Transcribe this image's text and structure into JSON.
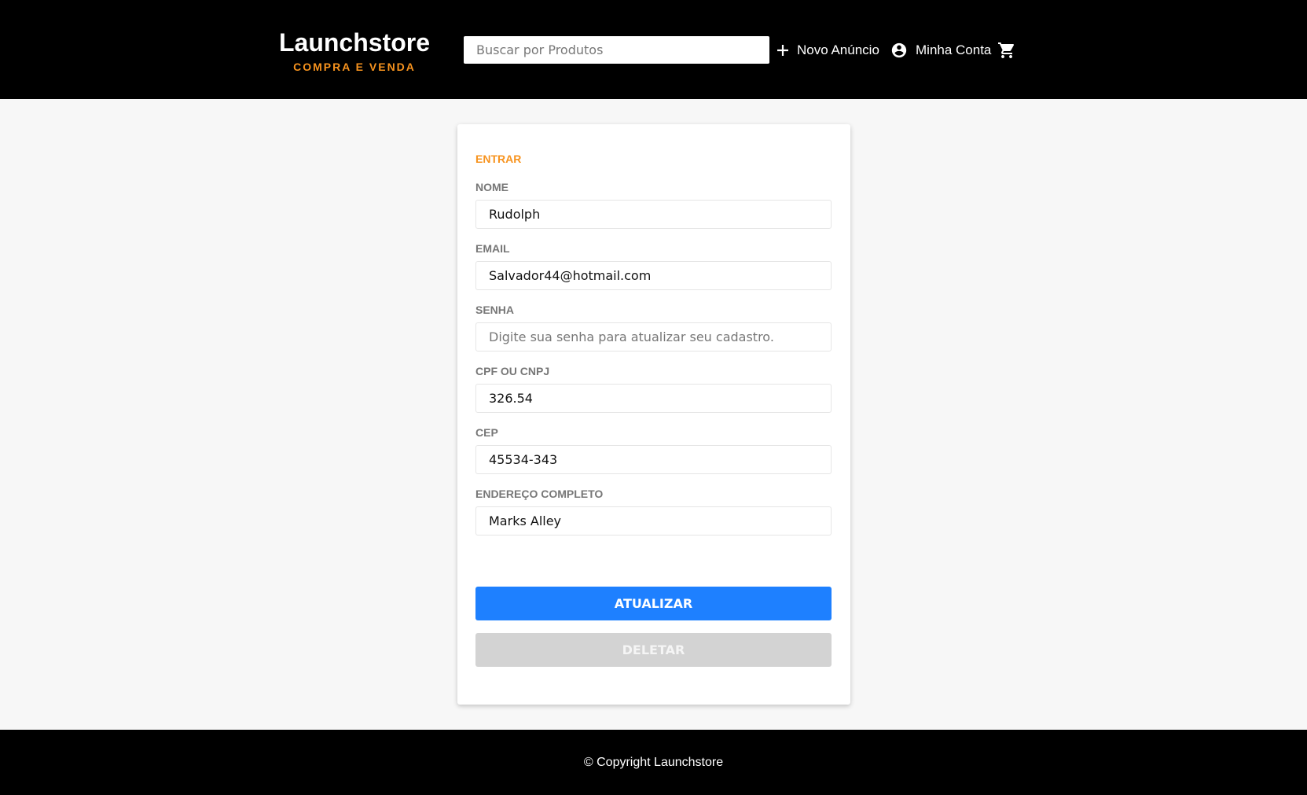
{
  "header": {
    "logo_title": "Launchstore",
    "logo_subtitle": "COMPRA E VENDA",
    "search_placeholder": "Buscar por Produtos",
    "new_ad_label": "Novo Anúncio",
    "account_label": "Minha Conta",
    "icons": {
      "new_ad": "plus-icon",
      "account": "account-circle-icon",
      "cart": "shopping-cart-icon"
    }
  },
  "form": {
    "heading": "ENTRAR",
    "fields": [
      {
        "label": "NOME",
        "value": "Rudolph",
        "placeholder": ""
      },
      {
        "label": "EMAIL",
        "value": "Salvador44@hotmail.com",
        "placeholder": ""
      },
      {
        "label": "SENHA",
        "value": "",
        "placeholder": "Digite sua senha para atualizar seu cadastro."
      },
      {
        "label": "CPF OU CNPJ",
        "value": "326.54",
        "placeholder": ""
      },
      {
        "label": "CEP",
        "value": "45534-343",
        "placeholder": ""
      },
      {
        "label": "ENDEREÇO COMPLETO",
        "value": "Marks Alley",
        "placeholder": ""
      }
    ],
    "update_button": "ATUALIZAR",
    "delete_button": "DELETAR"
  },
  "footer": {
    "copyright": "© Copyright Launchstore"
  },
  "colors": {
    "header_bg": "#000000",
    "accent_orange": "#f7931e",
    "primary_blue": "#1e80ff",
    "disabled_gray": "#d3d3d3",
    "page_bg": "#f7f7f7"
  }
}
